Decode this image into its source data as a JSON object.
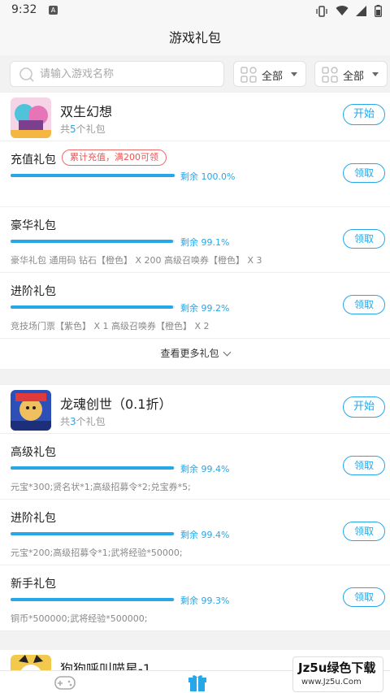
{
  "status_bar": {
    "time": "9:32",
    "notification_icon": "a-icon"
  },
  "header": {
    "title": "游戏礼包"
  },
  "filters": {
    "search_placeholder": "请输入游戏名称",
    "dropdown1_value": "全部",
    "dropdown2_value": "全部"
  },
  "games": [
    {
      "name": "双生幻想",
      "count_prefix": "共",
      "count": "5",
      "count_suffix": "个礼包",
      "start_label": "开始",
      "gifts": [
        {
          "name": "充值礼包",
          "badge": "累计充值，满200可领",
          "remain": "剩余 100.0%",
          "remain_fraction": 1.0,
          "desc": "",
          "claim_label": "领取"
        },
        {
          "name": "豪华礼包",
          "badge": "",
          "remain": "剩余 99.1%",
          "remain_fraction": 0.991,
          "desc": "豪华礼包  通用码  钻石【橙色】 X 200    高级召唤券【橙色】 X 3",
          "claim_label": "领取"
        },
        {
          "name": "进阶礼包",
          "badge": "",
          "remain": "剩余 99.2%",
          "remain_fraction": 0.992,
          "desc": "竞技场门票【紫色】 X 1 高级召唤券【橙色】 X 2",
          "claim_label": "领取"
        }
      ],
      "more_label": "查看更多礼包"
    },
    {
      "name": "龙魂创世（0.1折）",
      "count_prefix": "共",
      "count": "3",
      "count_suffix": "个礼包",
      "start_label": "开始",
      "gifts": [
        {
          "name": "高级礼包",
          "badge": "",
          "remain": "剩余 99.4%",
          "remain_fraction": 0.994,
          "desc": "元宝*300;贤名状*1;高级招募令*2;兑宝券*5;",
          "claim_label": "领取"
        },
        {
          "name": "进阶礼包",
          "badge": "",
          "remain": "剩余 99.4%",
          "remain_fraction": 0.994,
          "desc": "元宝*200;高级招募令*1;武将经验*50000;",
          "claim_label": "领取"
        },
        {
          "name": "新手礼包",
          "badge": "",
          "remain": "剩余 99.3%",
          "remain_fraction": 0.993,
          "desc": "铜币*500000;武将经验*500000;",
          "claim_label": "领取"
        }
      ]
    },
    {
      "name": "狗狗呼叫喵星-1"
    }
  ],
  "tabbar": {
    "items": [
      "gamepad-icon",
      "gift-icon",
      "user-icon"
    ]
  },
  "watermark": {
    "main": "Jz5u绿色下载",
    "sub": "www.Jz5u.Com"
  },
  "colors": {
    "accent": "#25a7e8",
    "badge_red": "#f05050"
  }
}
